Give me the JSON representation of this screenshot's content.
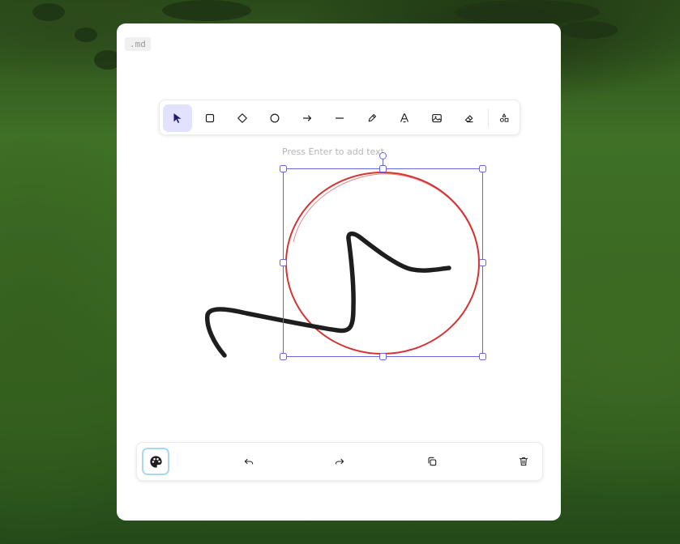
{
  "file_tag": ".md",
  "toolbar": {
    "tools": [
      {
        "name": "selection",
        "icon": "pointer-icon",
        "active": true
      },
      {
        "name": "rectangle",
        "icon": "rectangle-icon",
        "active": false
      },
      {
        "name": "diamond",
        "icon": "diamond-icon",
        "active": false
      },
      {
        "name": "ellipse",
        "icon": "circle-icon",
        "active": false
      },
      {
        "name": "arrow",
        "icon": "arrow-icon",
        "active": false
      },
      {
        "name": "line",
        "icon": "line-icon",
        "active": false
      },
      {
        "name": "draw",
        "icon": "pencil-icon",
        "active": false
      },
      {
        "name": "text",
        "icon": "text-icon",
        "active": false
      },
      {
        "name": "image",
        "icon": "image-icon",
        "active": false
      },
      {
        "name": "eraser",
        "icon": "eraser-icon",
        "active": false
      },
      {
        "name": "more-shapes",
        "icon": "shapes-icon",
        "active": false
      }
    ]
  },
  "canvas_hint": "Press Enter to add text",
  "colors": {
    "accent": "#6965db",
    "active_tool_bg": "#e3e2fe",
    "circle_stroke": "#d63333",
    "freedraw_stroke": "#1e1e1e",
    "palette_ring": "#a8d8f0"
  },
  "bottombar": {
    "buttons": [
      {
        "name": "palette",
        "icon": "palette-icon"
      },
      {
        "name": "undo",
        "icon": "undo-icon"
      },
      {
        "name": "redo",
        "icon": "redo-icon"
      },
      {
        "name": "duplicate",
        "icon": "duplicate-icon"
      },
      {
        "name": "delete",
        "icon": "trash-icon"
      }
    ]
  }
}
